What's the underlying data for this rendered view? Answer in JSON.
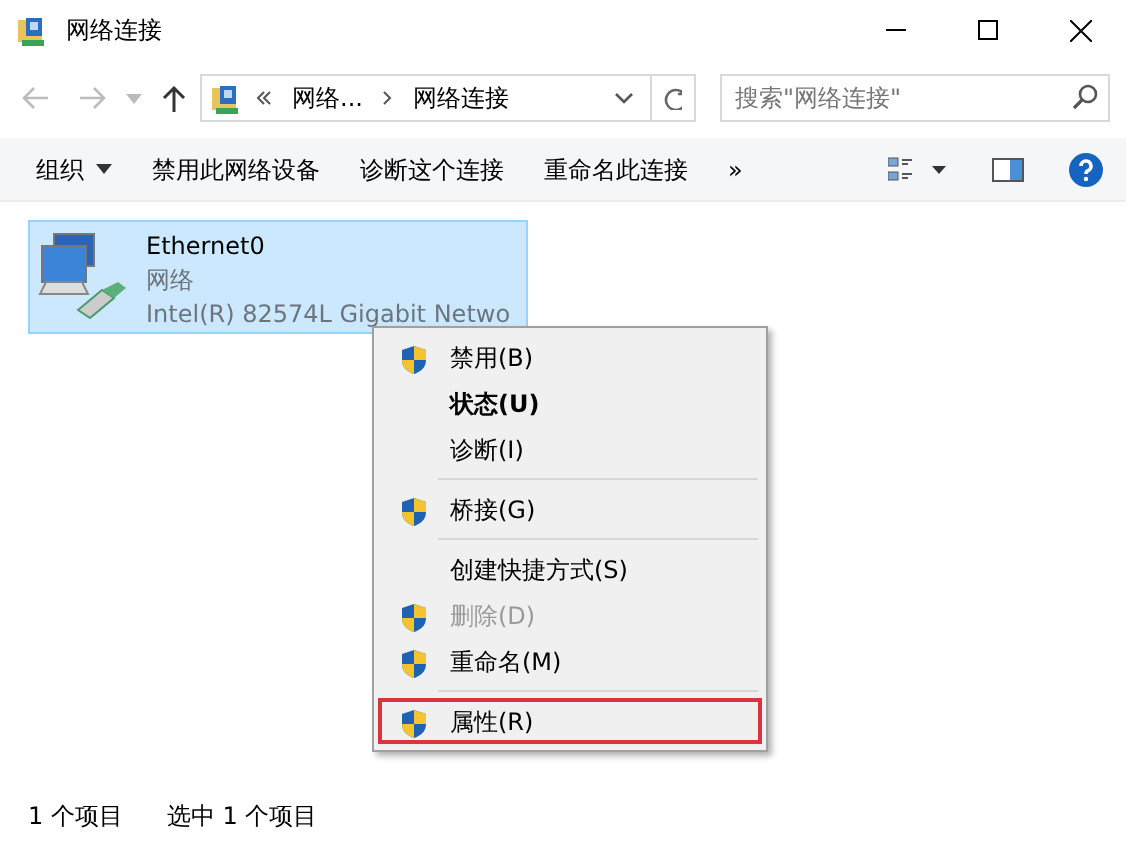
{
  "window": {
    "title": "网络连接"
  },
  "address": {
    "crumbs": [
      "网络...",
      "网络连接"
    ]
  },
  "search": {
    "placeholder": "搜索\"网络连接\""
  },
  "toolbar": [
    {
      "label": "组织",
      "dropdown": true
    },
    {
      "label": "禁用此网络设备",
      "dropdown": false
    },
    {
      "label": "诊断这个连接",
      "dropdown": false
    },
    {
      "label": "重命名此连接",
      "dropdown": false
    },
    {
      "label": "»",
      "dropdown": false
    }
  ],
  "adapters": [
    {
      "name": "Ethernet0",
      "network": "网络",
      "device": "Intel(R) 82574L Gigabit Netwo",
      "selected": true
    }
  ],
  "context_menu": {
    "items": [
      {
        "kind": "item",
        "label": "禁用(B)",
        "shield": true,
        "bold": false,
        "disabled": false,
        "highlighted": false
      },
      {
        "kind": "item",
        "label": "状态(U)",
        "shield": false,
        "bold": true,
        "disabled": false,
        "highlighted": false
      },
      {
        "kind": "item",
        "label": "诊断(I)",
        "shield": false,
        "bold": false,
        "disabled": false,
        "highlighted": false
      },
      {
        "kind": "separator"
      },
      {
        "kind": "item",
        "label": "桥接(G)",
        "shield": true,
        "bold": false,
        "disabled": false,
        "highlighted": false
      },
      {
        "kind": "separator"
      },
      {
        "kind": "item",
        "label": "创建快捷方式(S)",
        "shield": false,
        "bold": false,
        "disabled": false,
        "highlighted": false
      },
      {
        "kind": "item",
        "label": "删除(D)",
        "shield": true,
        "bold": false,
        "disabled": true,
        "highlighted": false
      },
      {
        "kind": "item",
        "label": "重命名(M)",
        "shield": true,
        "bold": false,
        "disabled": false,
        "highlighted": false
      },
      {
        "kind": "separator"
      },
      {
        "kind": "item",
        "label": "属性(R)",
        "shield": true,
        "bold": false,
        "disabled": false,
        "highlighted": true
      }
    ]
  },
  "status_bar": {
    "count": "1 个项目",
    "selection": "选中 1 个项目"
  }
}
